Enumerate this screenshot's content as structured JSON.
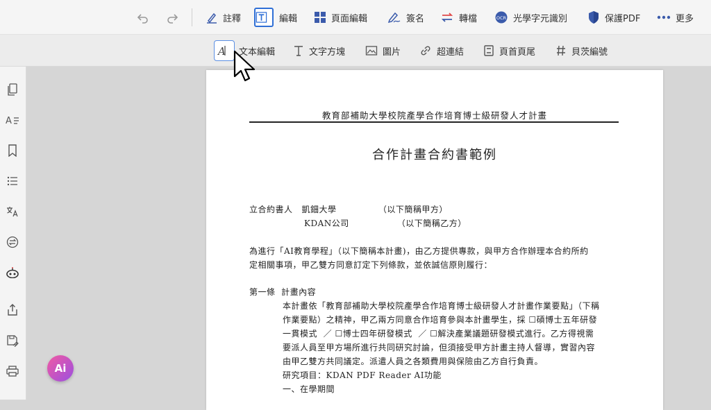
{
  "toolbar": {
    "items": [
      {
        "label": "註釋",
        "icon": "pen-icon"
      },
      {
        "label": "編輯",
        "icon": "text-edit-icon",
        "active": true
      },
      {
        "label": "頁面編輯",
        "icon": "grid-icon"
      },
      {
        "label": "簽名",
        "icon": "signature-icon"
      },
      {
        "label": "轉檔",
        "icon": "convert-icon"
      },
      {
        "label": "光學字元識別",
        "icon": "ocr-icon"
      },
      {
        "label": "保護PDF",
        "icon": "shield-icon"
      },
      {
        "label": "更多",
        "icon": "more-icon"
      }
    ],
    "accent": "#2f6fd6"
  },
  "subbar": {
    "items": [
      {
        "label": "文本編輯",
        "icon": "text-cursor-icon"
      },
      {
        "label": "文字方塊",
        "icon": "text-box-icon"
      },
      {
        "label": "圖片",
        "icon": "image-icon"
      },
      {
        "label": "超連結",
        "icon": "link-icon"
      },
      {
        "label": "頁首頁尾",
        "icon": "header-footer-icon"
      },
      {
        "label": "貝茨編號",
        "icon": "hash-icon"
      }
    ]
  },
  "ai_button": {
    "label": "Ai"
  },
  "document": {
    "header": "教育部補助大學校院產學合作培育博士級研發人才計畫",
    "title": "合作計畫合約書範例",
    "lines": [
      "立合約書人   凱鈿大學              （以下簡稱甲方）",
      "KDAN公司                （以下簡稱乙方）",
      "為進行「AI教育學程」（以下簡稱本計畫)，由乙方提供專款，與甲方合作辦理本合約所約",
      "定相關事項，甲乙雙方同意訂定下列條款，並依誠信原則履行：",
      "第一條  計畫內容",
      "本計畫依「教育部補助大學校院產學合作培育博士級研發人才計畫作業要點」（下稱",
      "作業要點）之精神，甲乙兩方同意合作培育參與本計畫學生，採 ☐碩博士五年研發",
      "一貫模式  ／ ☐博士四年研發模式  ／ ☐解決產業議題研發模式進行。乙方得視需",
      "要派人員至甲方場所進行共同研究討論，但須接受甲方計畫主持人督導，實習內容",
      "由甲乙雙方共同議定。派遣人員之各類費用與保險由乙方自行負責。",
      "研究項目：KDAN PDF Reader AI功能",
      "一、在學期間"
    ]
  }
}
